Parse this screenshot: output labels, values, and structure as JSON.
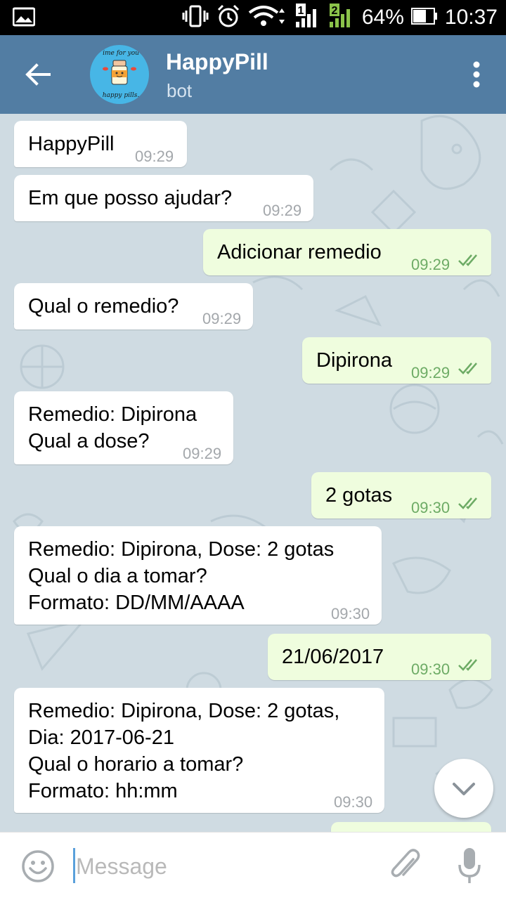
{
  "status_bar": {
    "battery": "64%",
    "time": "10:37",
    "sim1": "1",
    "sim2": "2"
  },
  "header": {
    "title": "HappyPill",
    "subtitle": "bot",
    "avatar_text_top": "ime for you",
    "avatar_text_bottom": "happy pills."
  },
  "messages": [
    {
      "dir": "in",
      "text": "HappyPill",
      "time": "09:29"
    },
    {
      "dir": "in",
      "text": "Em que posso ajudar?",
      "time": "09:29"
    },
    {
      "dir": "out",
      "text": "Adicionar remedio",
      "time": "09:29"
    },
    {
      "dir": "in",
      "text": "Qual o remedio?",
      "time": "09:29"
    },
    {
      "dir": "out",
      "text": "Dipirona",
      "time": "09:29"
    },
    {
      "dir": "in",
      "text": "Remedio: Dipirona\nQual a dose?",
      "time": "09:29"
    },
    {
      "dir": "out",
      "text": "2 gotas",
      "time": "09:30"
    },
    {
      "dir": "in",
      "text": "Remedio: Dipirona, Dose: 2 gotas\nQual o dia a tomar?\nFormato: DD/MM/AAAA",
      "time": "09:30"
    },
    {
      "dir": "out",
      "text": "21/06/2017",
      "time": "09:30"
    },
    {
      "dir": "in",
      "text": "Remedio: Dipirona, Dose: 2 gotas,\nDia: 2017-06-21\nQual o horario a tomar?\nFormato: hh:mm",
      "time": "09:30"
    }
  ],
  "input": {
    "placeholder": "Message"
  },
  "colors": {
    "header": "#527DA3",
    "chat_bg": "#CFDBE2",
    "outgoing": "#EFFDDE",
    "incoming": "#FFFFFF",
    "check": "#6DAB65"
  },
  "icons": [
    "back-arrow-icon",
    "more-vert-icon",
    "emoji-icon",
    "attach-icon",
    "mic-icon",
    "scroll-down-icon",
    "double-check-icon"
  ]
}
